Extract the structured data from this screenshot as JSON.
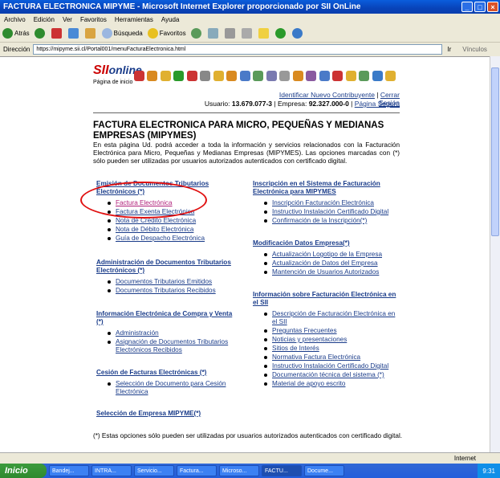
{
  "window": {
    "title": "FACTURA ELECTRONICA MIPYME - Microsoft Internet Explorer proporcionado por SII OnLine"
  },
  "menu": [
    "Archivo",
    "Edición",
    "Ver",
    "Favoritos",
    "Herramientas",
    "Ayuda"
  ],
  "toolbar": {
    "back": "Atrás",
    "search": "Búsqueda",
    "favorites": "Favoritos"
  },
  "address": {
    "label": "Dirección",
    "url": "https://mipyme.sii.cl/Portal001/menuFacturaElectronica.html",
    "go": "Ir",
    "links": "Vínculos"
  },
  "header": {
    "logo_main": "SII",
    "logo_sub": "online",
    "home": "Página de inicio",
    "link_new": "Identificar Nuevo Contribuyente",
    "link_logout": "Cerrar Sesión",
    "user_label": "Usuario:",
    "user": "13.679.077-3",
    "company_label": "Empresa:",
    "company": "92.327.000-0",
    "secure_page": "Página Segura"
  },
  "main": {
    "title": "FACTURA ELECTRONICA PARA MICRO, PEQUEÑAS Y MEDIANAS EMPRESAS (MIPYMES)",
    "intro": "En esta página Ud. podrá acceder a toda la información y servicios relacionados con la Facturación Electrónica para Micro, Pequeñas y Medianas Empresas (MIPYMES). Las opciones marcadas con (*) sólo pueden ser utilizadas por usuarios autorizados autenticados con certificado digital.",
    "left": [
      {
        "title": "Emisión de Documentos Tributarios Electrónicos (*)",
        "items": [
          "Factura Electrónica",
          "Factura Exenta Electrónica",
          "Nota de Crédito Electrónica",
          "Nota de Débito Electrónica",
          "Guía de Despacho Electrónica"
        ]
      },
      {
        "title": "Administración de Documentos Tributarios Electrónicos (*)",
        "items": [
          "Documentos Tributarios Emitidos",
          "Documentos Tributarios Recibidos"
        ]
      },
      {
        "title": "Información Electrónica de Compra y Venta (*)",
        "items": [
          "Administración",
          "Asignación de Documentos Tributarios Electrónicos Recibidos"
        ]
      },
      {
        "title": "Cesión de Facturas Electrónicas (*)",
        "items": [
          "Selección de Documento para Cesión Electrónica"
        ]
      },
      {
        "title": "Selección de Empresa MIPYME(*)",
        "items": []
      }
    ],
    "right": [
      {
        "title": "Inscripción en el Sistema de Facturación Electrónica para MIPYMES",
        "items": [
          "Inscripción Facturación Electrónica",
          "Instructivo Instalación Certificado Digital",
          "Confirmación de la Inscripción(*)"
        ]
      },
      {
        "title": "Modificación Datos Empresa(*)",
        "items": [
          "Actualización Logotipo de la Empresa",
          "Actualización de Datos del Empresa",
          "Mantención de Usuarios Autorizados"
        ]
      },
      {
        "title": "Información sobre Facturación Electrónica en el SII",
        "items": [
          "Descripción de Facturación Electrónica en el SII",
          "Preguntas Frecuentes",
          "Noticias y presentaciones",
          "Sitios de Interés",
          "Normativa Factura Electrónica",
          "Instructivo Instalación Certificado Digital",
          "Documentación técnica del sistema (*)",
          "Material de apoyo escrito"
        ]
      }
    ],
    "footnote": "(*) Estas opciones sólo pueden ser utilizadas por usuarios autorizados autenticados con certificado digital."
  },
  "statusbar": {
    "zone": "Internet"
  },
  "taskbar": {
    "start": "Inicio",
    "tasks": [
      "Bandej...",
      "INTRA...",
      "Servicio...",
      "Factura...",
      "Microso...",
      "FACTU...",
      "Docume..."
    ],
    "clock": "9:31"
  }
}
